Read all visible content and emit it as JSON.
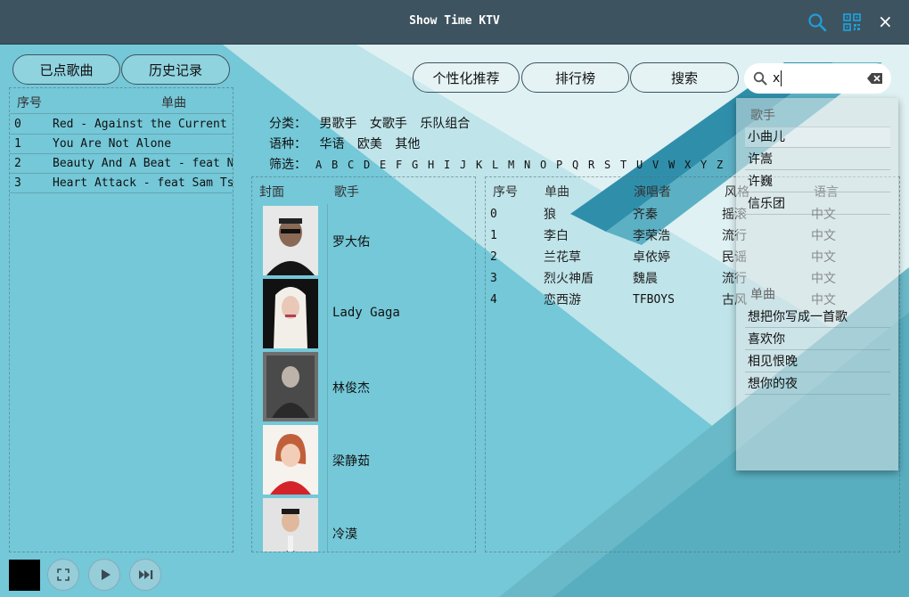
{
  "app": {
    "title": "Show Time KTV"
  },
  "colors": {
    "titlebar": "#3e5360",
    "accent": "#1f9ed8",
    "background": "#74c8d8"
  },
  "titlebar_icons": [
    "search-icon",
    "qr-code-icon",
    "close-icon"
  ],
  "close_glyph": "×",
  "left": {
    "tabs": [
      "已点歌曲",
      "历史记录"
    ],
    "headers": {
      "index": "序号",
      "song": "单曲"
    },
    "rows": [
      {
        "index": "0",
        "song": "Red - Against the Current"
      },
      {
        "index": "1",
        "song": "You Are Not Alone"
      },
      {
        "index": "2",
        "song": "Beauty And A Beat - feat Nicki Minaj"
      },
      {
        "index": "3",
        "song": "Heart Attack - feat Sam Tsui"
      }
    ]
  },
  "nav": {
    "buttons": [
      "个性化推荐",
      "排行榜",
      "搜索"
    ]
  },
  "filters": {
    "category_label": "分类：",
    "categories": [
      "男歌手",
      "女歌手",
      "乐队组合"
    ],
    "language_label": "语种：",
    "languages": [
      "华语",
      "欧美",
      "其他"
    ],
    "filter_label": "筛选：",
    "letters": [
      "A",
      "B",
      "C",
      "D",
      "E",
      "F",
      "G",
      "H",
      "I",
      "J",
      "K",
      "L",
      "M",
      "N",
      "O",
      "P",
      "Q",
      "R",
      "S",
      "T",
      "U",
      "V",
      "W",
      "X",
      "Y",
      "Z"
    ]
  },
  "singers": {
    "headers": {
      "cover": "封面",
      "singer": "歌手"
    },
    "items": [
      "罗大佑",
      "Lady Gaga",
      "林俊杰",
      "梁静茹",
      "冷漠"
    ]
  },
  "songs": {
    "headers": {
      "index": "序号",
      "song": "单曲",
      "artist": "演唱者",
      "style": "风格",
      "language": "语言"
    },
    "rows": [
      {
        "index": "0",
        "song": "狼",
        "artist": "齐秦",
        "style": "摇滚",
        "language": "中文"
      },
      {
        "index": "1",
        "song": "李白",
        "artist": "李荣浩",
        "style": "流行",
        "language": "中文"
      },
      {
        "index": "2",
        "song": "兰花草",
        "artist": "卓依婷",
        "style": "民谣",
        "language": "中文"
      },
      {
        "index": "3",
        "song": "烈火神盾",
        "artist": "魏晨",
        "style": "流行",
        "language": "中文"
      },
      {
        "index": "4",
        "song": "恋西游",
        "artist": "TFBOYS",
        "style": "古风",
        "language": "中文"
      }
    ]
  },
  "search": {
    "value": "x",
    "singer_header": "歌手",
    "singer_results": [
      "小曲儿",
      "许嵩",
      "许巍",
      "信乐团"
    ],
    "song_header": "单曲",
    "song_results": [
      "想把你写成一首歌",
      "喜欢你",
      "相见恨晚",
      "想你的夜"
    ]
  },
  "player": {
    "controls": [
      "fullscreen-icon",
      "play-icon",
      "next-track-icon"
    ]
  }
}
